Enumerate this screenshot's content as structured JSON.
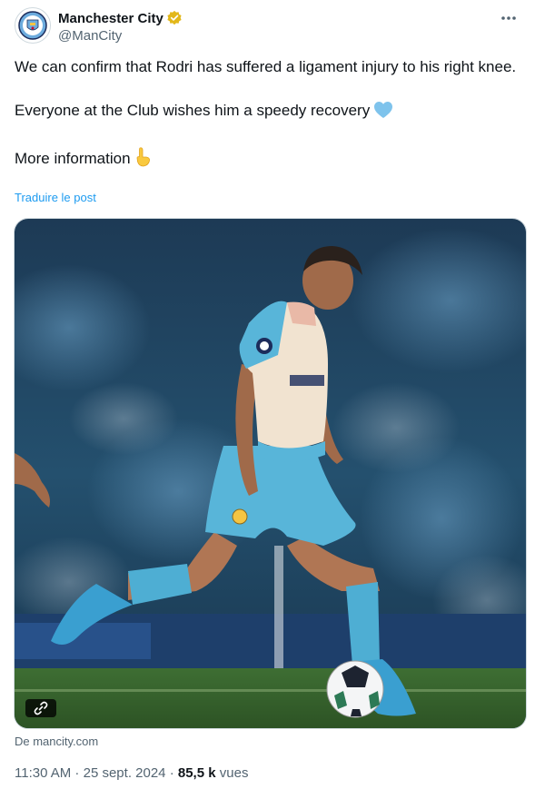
{
  "author": {
    "display_name": "Manchester City",
    "handle": "@ManCity"
  },
  "tweet": {
    "line1": "We can confirm that Rodri has suffered a ligament injury to his right knee.",
    "line2": "Everyone at the Club wishes him a speedy recovery",
    "line3": "More information",
    "emoji2": "blue-heart-icon",
    "emoji3": "pointing-down-icon"
  },
  "translate_label": "Traduire le post",
  "media": {
    "source_label": "De mancity.com",
    "link_icon": "link-icon"
  },
  "meta": {
    "time": "11:30 AM",
    "separator1": " · ",
    "date": "25 sept. 2024",
    "separator2": " · ",
    "views_count": "85,5 k",
    "views_label": " vues"
  },
  "colors": {
    "accent": "#1d9bf0",
    "verified": "#e2b719",
    "secondary_text": "#536471",
    "kit_blue": "#5bb8d9"
  }
}
